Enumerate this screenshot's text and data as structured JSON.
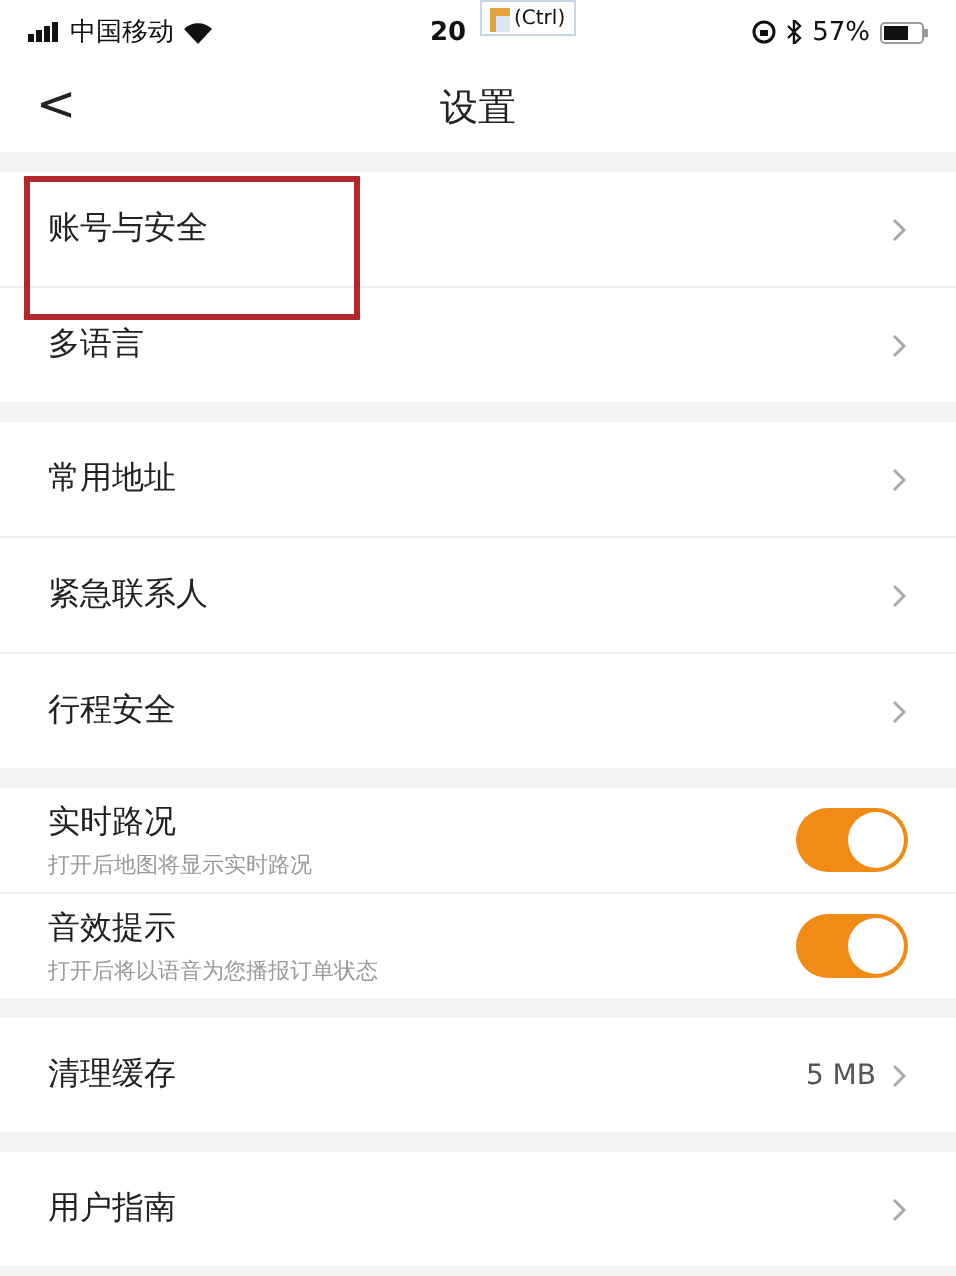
{
  "status_bar": {
    "carrier": "中国移动",
    "time": "20",
    "battery": "57%"
  },
  "paste_popup": {
    "label": "(Ctrl)"
  },
  "nav": {
    "back": "<",
    "title": "设置"
  },
  "annotation": {
    "kind": "frame",
    "color": "#b3262a"
  },
  "groups": [
    {
      "items": [
        {
          "kind": "link",
          "label": "账号与安全"
        },
        {
          "kind": "link",
          "label": "多语言"
        }
      ]
    },
    {
      "items": [
        {
          "kind": "link",
          "label": "常用地址"
        },
        {
          "kind": "link",
          "label": "紧急联系人"
        },
        {
          "kind": "link",
          "label": "行程安全"
        }
      ]
    },
    {
      "items": [
        {
          "kind": "toggle",
          "label": "实时路况",
          "hint": "打开后地图将显示实时路况",
          "on": true
        },
        {
          "kind": "toggle",
          "label": "音效提示",
          "hint": "打开后将以语音为您播报订单状态",
          "on": true
        }
      ]
    },
    {
      "items": [
        {
          "kind": "link",
          "label": "清理缓存",
          "value": "5 MB"
        }
      ]
    },
    {
      "items": [
        {
          "kind": "link",
          "label": "用户指南"
        }
      ]
    }
  ]
}
